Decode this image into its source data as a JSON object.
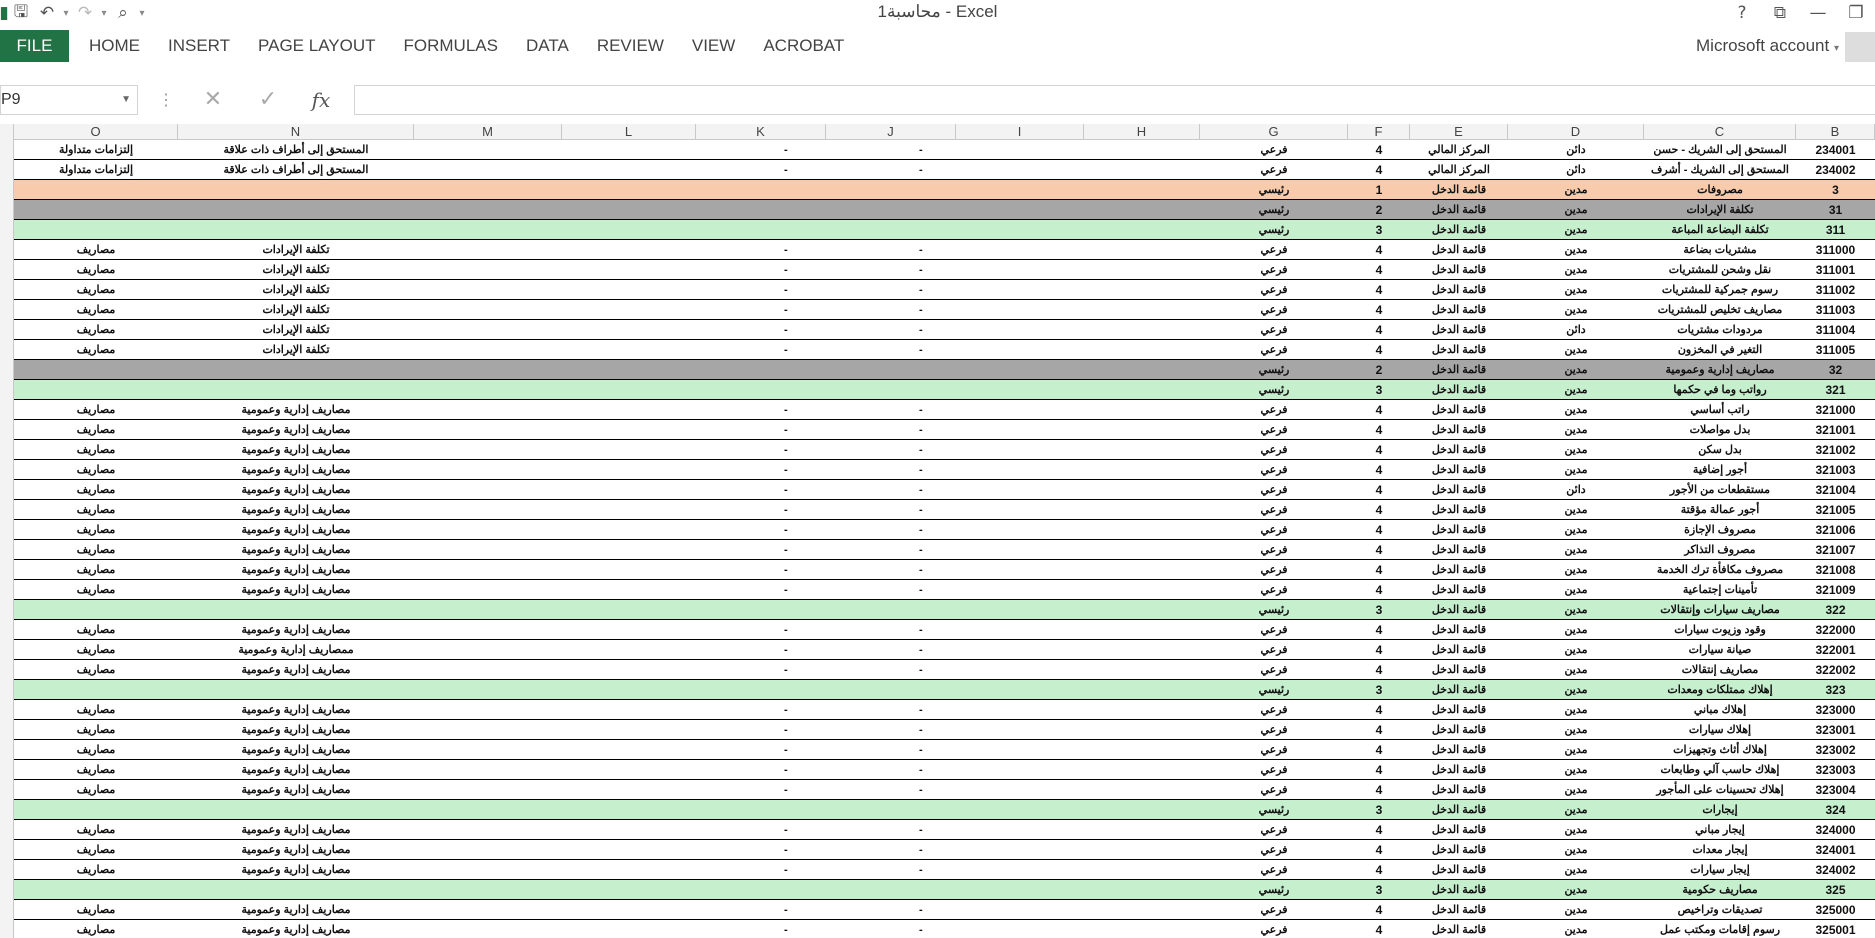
{
  "window": {
    "title": "محاسبة1 - Excel",
    "help": "?",
    "controls": [
      "ribbon-display",
      "minimize",
      "restore"
    ]
  },
  "ribbon": {
    "file": "FILE",
    "tabs": [
      "HOME",
      "INSERT",
      "PAGE LAYOUT",
      "FORMULAS",
      "DATA",
      "REVIEW",
      "VIEW",
      "ACROBAT"
    ],
    "account": "Microsoft account"
  },
  "formula_bar": {
    "name_box": "P9",
    "fx": "fx",
    "value": ""
  },
  "columns": [
    "O",
    "N",
    "M",
    "L",
    "K",
    "J",
    "I",
    "H",
    "G",
    "F",
    "E",
    "D",
    "C",
    "B"
  ],
  "rows": [
    {
      "style": "white",
      "B": "234001",
      "C": "المستحق إلى الشريك - حسن",
      "D": "دائن",
      "E": "المركز المالي",
      "F": "4",
      "G": "فرعي",
      "J": "-",
      "K": "-",
      "N": "المستحق إلى أطراف ذات علاقة",
      "O": "إلتزامات متداولة"
    },
    {
      "style": "white",
      "B": "234002",
      "C": "المستحق إلى الشريك - أشرف",
      "D": "دائن",
      "E": "المركز المالي",
      "F": "4",
      "G": "فرعي",
      "J": "-",
      "K": "-",
      "N": "المستحق إلى أطراف ذات علاقة",
      "O": "إلتزامات متداولة"
    },
    {
      "style": "salmon",
      "B": "3",
      "C": "مصروفات",
      "D": "مدين",
      "E": "قائمة الدخل",
      "F": "1",
      "G": "رئيسي",
      "J": "",
      "K": "",
      "N": "",
      "O": ""
    },
    {
      "style": "darkgray",
      "B": "31",
      "C": "تكلفة الإيرادات",
      "D": "مدين",
      "E": "قائمة الدخل",
      "F": "2",
      "G": "رئيسي",
      "J": "",
      "K": "",
      "N": "",
      "O": ""
    },
    {
      "style": "green",
      "B": "311",
      "C": "تكلفة البضاعة المباعة",
      "D": "مدين",
      "E": "قائمة الدخل",
      "F": "3",
      "G": "رئيسي",
      "J": "",
      "K": "",
      "N": "",
      "O": ""
    },
    {
      "style": "white",
      "B": "311000",
      "C": "مشتريات بضاعة",
      "D": "مدين",
      "E": "قائمة الدخل",
      "F": "4",
      "G": "فرعي",
      "J": "-",
      "K": "-",
      "N": "تكلفة الإيرادات",
      "O": "مصاريف"
    },
    {
      "style": "white",
      "B": "311001",
      "C": "نقل وشحن للمشتريات",
      "D": "مدين",
      "E": "قائمة الدخل",
      "F": "4",
      "G": "فرعي",
      "J": "-",
      "K": "-",
      "N": "تكلفة الإيرادات",
      "O": "مصاريف"
    },
    {
      "style": "white",
      "B": "311002",
      "C": "رسوم جمركية للمشتريات",
      "D": "مدين",
      "E": "قائمة الدخل",
      "F": "4",
      "G": "فرعي",
      "J": "-",
      "K": "-",
      "N": "تكلفة الإيرادات",
      "O": "مصاريف"
    },
    {
      "style": "white",
      "B": "311003",
      "C": "مصاريف تخليص للمشتريات",
      "D": "مدين",
      "E": "قائمة الدخل",
      "F": "4",
      "G": "فرعي",
      "J": "-",
      "K": "-",
      "N": "تكلفة الإيرادات",
      "O": "مصاريف"
    },
    {
      "style": "white",
      "B": "311004",
      "C": "مردودات مشتريات",
      "D": "دائن",
      "E": "قائمة الدخل",
      "F": "4",
      "G": "فرعي",
      "J": "-",
      "K": "-",
      "N": "تكلفة الإيرادات",
      "O": "مصاريف"
    },
    {
      "style": "white",
      "B": "311005",
      "C": "التغير في المخزون",
      "D": "مدين",
      "E": "قائمة الدخل",
      "F": "4",
      "G": "فرعي",
      "J": "-",
      "K": "-",
      "N": "تكلفة الإيرادات",
      "O": "مصاريف"
    },
    {
      "style": "darkgray",
      "B": "32",
      "C": "مصاريف إدارية وعمومية",
      "D": "مدين",
      "E": "قائمة الدخل",
      "F": "2",
      "G": "رئيسي",
      "J": "",
      "K": "",
      "N": "",
      "O": ""
    },
    {
      "style": "green",
      "B": "321",
      "C": "رواتب وما في حكمها",
      "D": "مدين",
      "E": "قائمة الدخل",
      "F": "3",
      "G": "رئيسي",
      "J": "",
      "K": "",
      "N": "",
      "O": ""
    },
    {
      "style": "white",
      "B": "321000",
      "C": "راتب أساسي",
      "D": "مدين",
      "E": "قائمة الدخل",
      "F": "4",
      "G": "فرعي",
      "J": "-",
      "K": "-",
      "N": "مصاريف إدارية وعمومية",
      "O": "مصاريف"
    },
    {
      "style": "white",
      "B": "321001",
      "C": "بدل مواصلات",
      "D": "مدين",
      "E": "قائمة الدخل",
      "F": "4",
      "G": "فرعي",
      "J": "-",
      "K": "-",
      "N": "مصاريف إدارية وعمومية",
      "O": "مصاريف"
    },
    {
      "style": "white",
      "B": "321002",
      "C": "بدل سكن",
      "D": "مدين",
      "E": "قائمة الدخل",
      "F": "4",
      "G": "فرعي",
      "J": "-",
      "K": "-",
      "N": "مصاريف إدارية وعمومية",
      "O": "مصاريف"
    },
    {
      "style": "white",
      "B": "321003",
      "C": "أجور إضافية",
      "D": "مدين",
      "E": "قائمة الدخل",
      "F": "4",
      "G": "فرعي",
      "J": "-",
      "K": "-",
      "N": "مصاريف إدارية وعمومية",
      "O": "مصاريف"
    },
    {
      "style": "white",
      "B": "321004",
      "C": "مستقطعات من الأجور",
      "D": "دائن",
      "E": "قائمة الدخل",
      "F": "4",
      "G": "فرعي",
      "J": "-",
      "K": "-",
      "N": "مصاريف إدارية وعمومية",
      "O": "مصاريف"
    },
    {
      "style": "white",
      "B": "321005",
      "C": "أجور عمالة مؤقتة",
      "D": "مدين",
      "E": "قائمة الدخل",
      "F": "4",
      "G": "فرعي",
      "J": "-",
      "K": "-",
      "N": "مصاريف إدارية وعمومية",
      "O": "مصاريف"
    },
    {
      "style": "white",
      "B": "321006",
      "C": "مصروف الإجازة",
      "D": "مدين",
      "E": "قائمة الدخل",
      "F": "4",
      "G": "فرعي",
      "J": "-",
      "K": "-",
      "N": "مصاريف إدارية وعمومية",
      "O": "مصاريف"
    },
    {
      "style": "white",
      "B": "321007",
      "C": "مصروف التذاكر",
      "D": "مدين",
      "E": "قائمة الدخل",
      "F": "4",
      "G": "فرعي",
      "J": "-",
      "K": "-",
      "N": "مصاريف إدارية وعمومية",
      "O": "مصاريف"
    },
    {
      "style": "white",
      "B": "321008",
      "C": "مصروف مكافأة ترك الخدمة",
      "D": "مدين",
      "E": "قائمة الدخل",
      "F": "4",
      "G": "فرعي",
      "J": "-",
      "K": "-",
      "N": "مصاريف إدارية وعمومية",
      "O": "مصاريف"
    },
    {
      "style": "white",
      "B": "321009",
      "C": "تأمينات إجتماعية",
      "D": "مدين",
      "E": "قائمة الدخل",
      "F": "4",
      "G": "فرعي",
      "J": "-",
      "K": "-",
      "N": "مصاريف إدارية وعمومية",
      "O": "مصاريف"
    },
    {
      "style": "green",
      "B": "322",
      "C": "مصاريف سيارات وإنتقالات",
      "D": "مدين",
      "E": "قائمة الدخل",
      "F": "3",
      "G": "رئيسي",
      "J": "",
      "K": "",
      "N": "",
      "O": ""
    },
    {
      "style": "white",
      "B": "322000",
      "C": "وقود وزيوت سيارات",
      "D": "مدين",
      "E": "قائمة الدخل",
      "F": "4",
      "G": "فرعي",
      "J": "-",
      "K": "-",
      "N": "مصاريف إدارية وعمومية",
      "O": "مصاريف"
    },
    {
      "style": "white",
      "B": "322001",
      "C": "صيانة سيارات",
      "D": "مدين",
      "E": "قائمة الدخل",
      "F": "4",
      "G": "فرعي",
      "J": "-",
      "K": "-",
      "N": "ممصاريف إدارية وعمومية",
      "O": "مصاريف"
    },
    {
      "style": "white",
      "B": "322002",
      "C": "مصاريف إنتقالات",
      "D": "مدين",
      "E": "قائمة الدخل",
      "F": "4",
      "G": "فرعي",
      "J": "-",
      "K": "-",
      "N": "مصاريف إدارية وعمومية",
      "O": "مصاريف"
    },
    {
      "style": "green",
      "B": "323",
      "C": "إهلاك ممتلكات ومعدات",
      "D": "مدين",
      "E": "قائمة الدخل",
      "F": "3",
      "G": "رئيسي",
      "J": "",
      "K": "",
      "N": "",
      "O": ""
    },
    {
      "style": "white",
      "B": "323000",
      "C": "إهلاك مباني",
      "D": "مدين",
      "E": "قائمة الدخل",
      "F": "4",
      "G": "فرعي",
      "J": "-",
      "K": "-",
      "N": "مصاريف إدارية وعمومية",
      "O": "مصاريف"
    },
    {
      "style": "white",
      "B": "323001",
      "C": "إهلاك سيارات",
      "D": "مدين",
      "E": "قائمة الدخل",
      "F": "4",
      "G": "فرعي",
      "J": "-",
      "K": "-",
      "N": "مصاريف إدارية وعمومية",
      "O": "مصاريف"
    },
    {
      "style": "white",
      "B": "323002",
      "C": "إهلاك أثاث وتجهيزات",
      "D": "مدين",
      "E": "قائمة الدخل",
      "F": "4",
      "G": "فرعي",
      "J": "-",
      "K": "-",
      "N": "مصاريف إدارية وعمومية",
      "O": "مصاريف"
    },
    {
      "style": "white",
      "B": "323003",
      "C": "إهلاك حاسب آلي وطابعات",
      "D": "مدين",
      "E": "قائمة الدخل",
      "F": "4",
      "G": "فرعي",
      "J": "-",
      "K": "-",
      "N": "مصاريف إدارية وعمومية",
      "O": "مصاريف"
    },
    {
      "style": "white",
      "B": "323004",
      "C": "إهلاك تحسينات على المأجور",
      "D": "مدين",
      "E": "قائمة الدخل",
      "F": "4",
      "G": "فرعي",
      "J": "-",
      "K": "-",
      "N": "مصاريف إدارية وعمومية",
      "O": "مصاريف"
    },
    {
      "style": "green",
      "B": "324",
      "C": "إيجارات",
      "D": "مدين",
      "E": "قائمة الدخل",
      "F": "3",
      "G": "رئيسي",
      "J": "",
      "K": "",
      "N": "",
      "O": ""
    },
    {
      "style": "white",
      "B": "324000",
      "C": "إيجار مباني",
      "D": "مدين",
      "E": "قائمة الدخل",
      "F": "4",
      "G": "فرعي",
      "J": "-",
      "K": "-",
      "N": "مصاريف إدارية وعمومية",
      "O": "مصاريف"
    },
    {
      "style": "white",
      "B": "324001",
      "C": "إيجار معدات",
      "D": "مدين",
      "E": "قائمة الدخل",
      "F": "4",
      "G": "فرعي",
      "J": "-",
      "K": "-",
      "N": "مصاريف إدارية وعمومية",
      "O": "مصاريف"
    },
    {
      "style": "white",
      "B": "324002",
      "C": "إيجار سيارات",
      "D": "مدين",
      "E": "قائمة الدخل",
      "F": "4",
      "G": "فرعي",
      "J": "-",
      "K": "-",
      "N": "مصاريف إدارية وعمومية",
      "O": "مصاريف"
    },
    {
      "style": "green",
      "B": "325",
      "C": "مصاريف حكومية",
      "D": "مدين",
      "E": "قائمة الدخل",
      "F": "3",
      "G": "رئيسي",
      "J": "",
      "K": "",
      "N": "",
      "O": ""
    },
    {
      "style": "white",
      "B": "325000",
      "C": "تصديقات وتراخيص",
      "D": "مدين",
      "E": "قائمة الدخل",
      "F": "4",
      "G": "فرعي",
      "J": "-",
      "K": "-",
      "N": "مصاريف إدارية وعمومية",
      "O": "مصاريف"
    },
    {
      "style": "white",
      "B": "325001",
      "C": "رسوم إقامات ومكتب عمل",
      "D": "مدين",
      "E": "قائمة الدخل",
      "F": "4",
      "G": "فرعي",
      "J": "-",
      "K": "-",
      "N": "مصاريف إدارية وعمومية",
      "O": "مصاريف"
    }
  ]
}
